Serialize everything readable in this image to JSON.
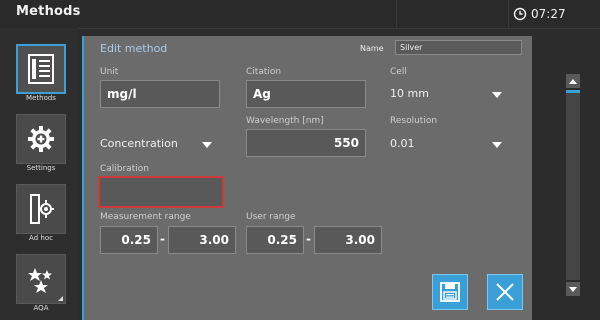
{
  "app": {
    "title": "Methods",
    "time": "07:27"
  },
  "sidebar": {
    "items": [
      {
        "label": "Methods",
        "icon": "methods-list-icon",
        "active": true
      },
      {
        "label": "Settings",
        "icon": "gear-icon",
        "active": false
      },
      {
        "label": "Ad hoc",
        "icon": "adhoc-icon",
        "active": false
      },
      {
        "label": "AQA",
        "icon": "aqa-stars-icon",
        "active": false
      }
    ]
  },
  "dialog": {
    "title": "Edit method",
    "name_label": "Name",
    "name_value": "Silver",
    "unit": {
      "label": "Unit",
      "value": "mg/l"
    },
    "citation": {
      "label": "Citation",
      "value": "Ag"
    },
    "cell": {
      "label": "Cell",
      "value": "10 mm"
    },
    "mode": {
      "value": "Concentration"
    },
    "wavelength": {
      "label": "Wavelength [nm]",
      "value": "550"
    },
    "resolution": {
      "label": "Resolution",
      "value": "0.01"
    },
    "calibration": {
      "label": "Calibration",
      "value": ""
    },
    "measurement_range": {
      "label": "Measurement range",
      "min": "0.25",
      "max": "3.00"
    },
    "user_range": {
      "label": "User range",
      "min": "0.25",
      "max": "3.00"
    },
    "dash": "-"
  },
  "colors": {
    "accent": "#3aa0d8",
    "error_border": "#cc3a3a",
    "dialog_bg": "#6b6b6b",
    "field_bg": "#595959"
  }
}
